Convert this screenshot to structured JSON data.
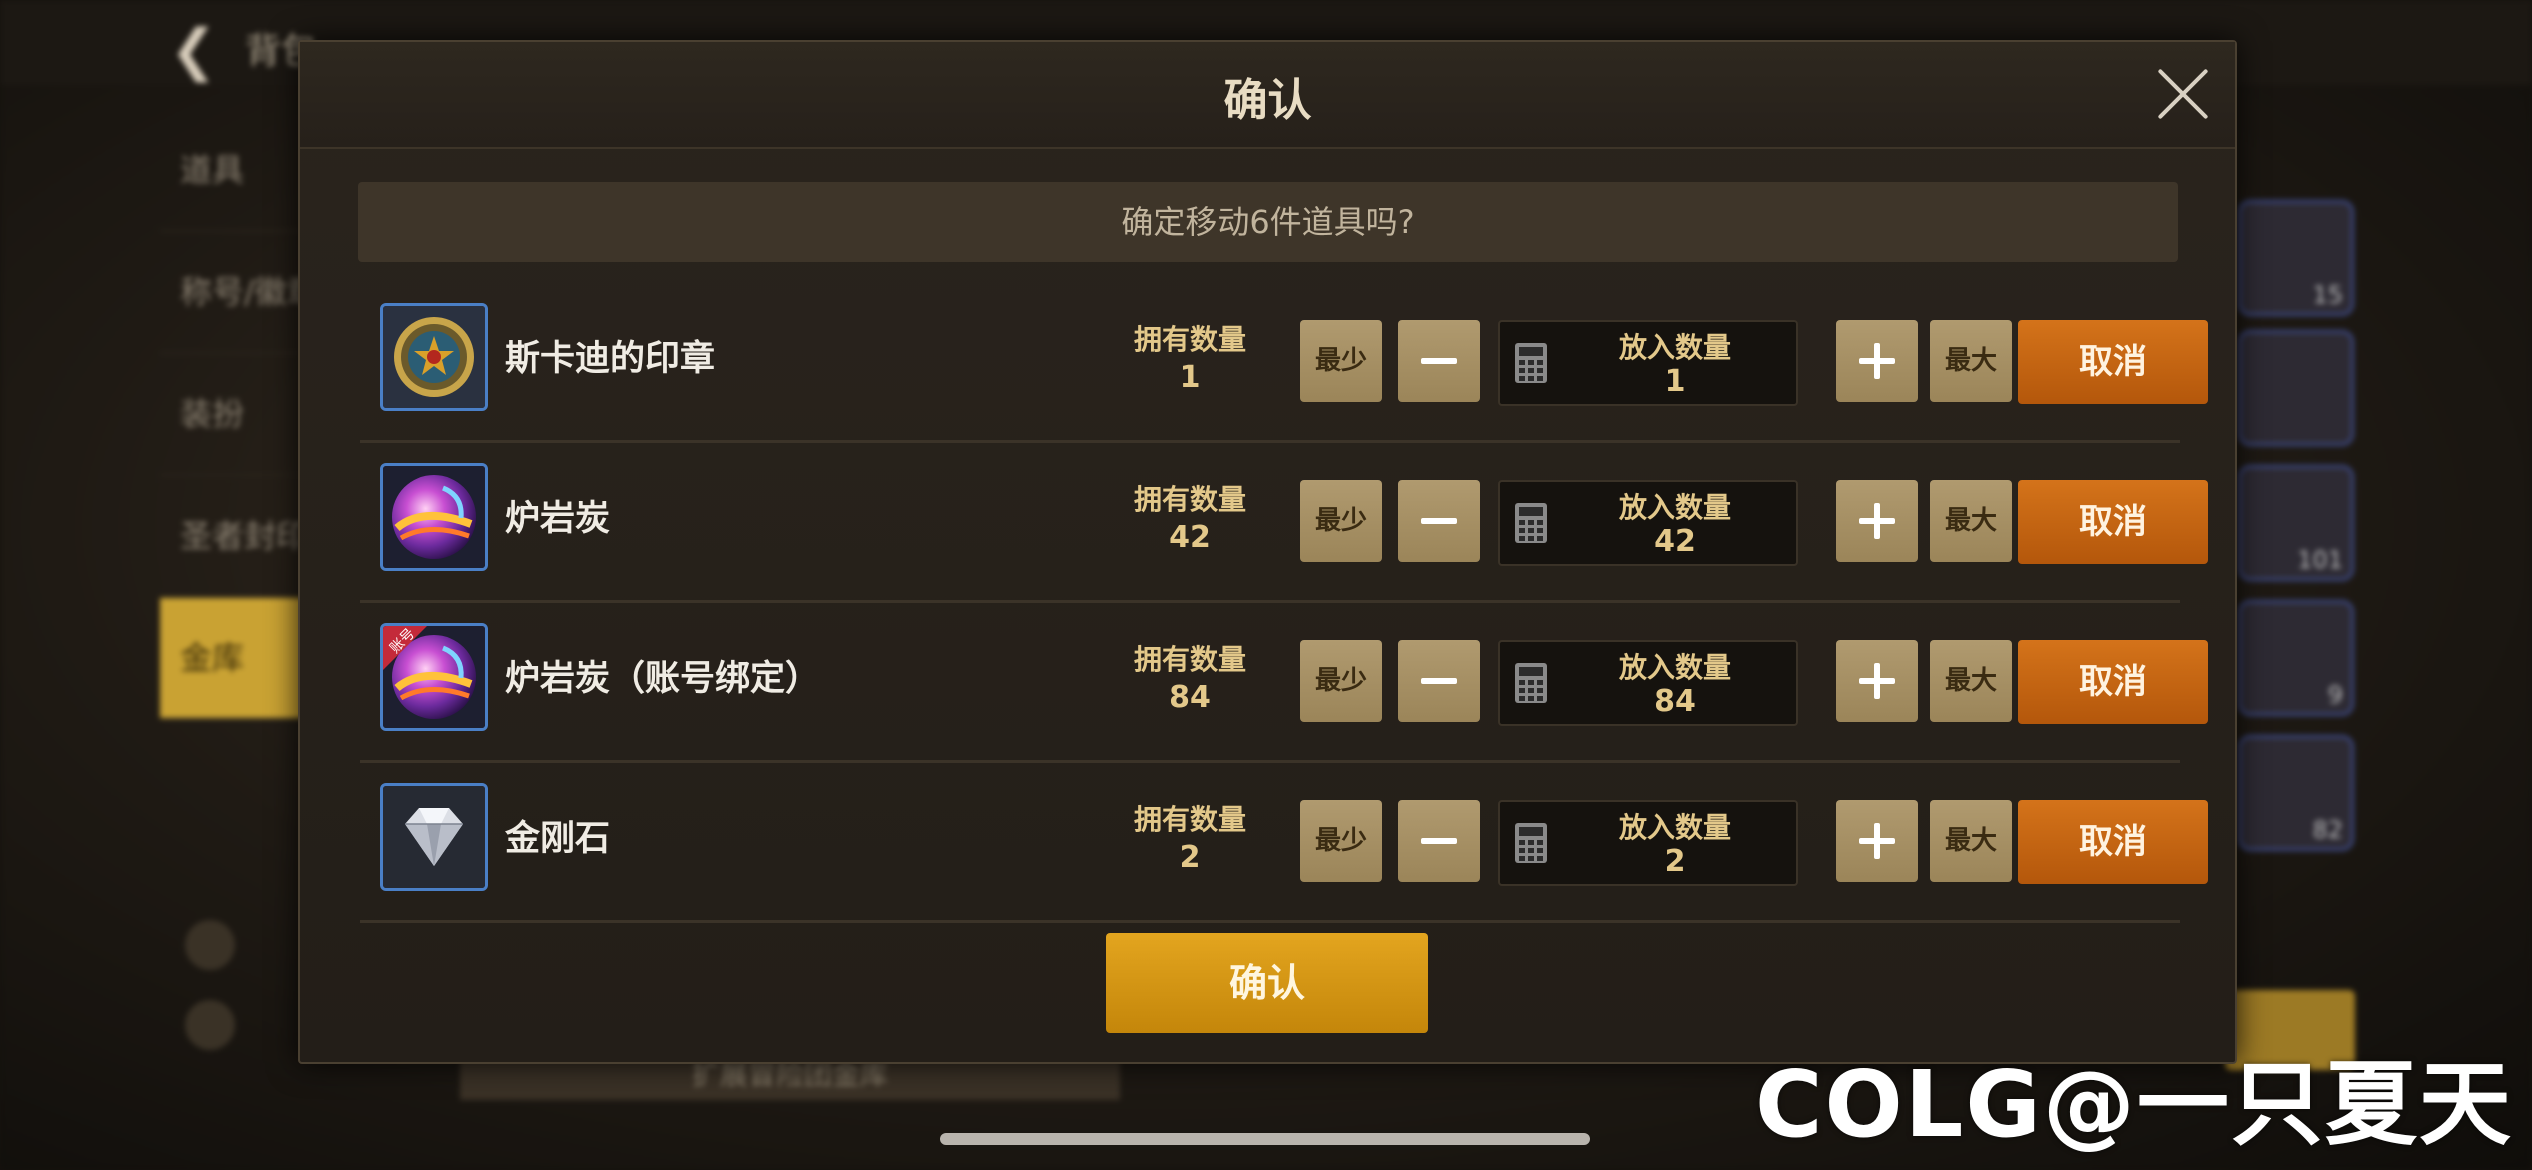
{
  "background": {
    "top_title": "背包",
    "sidebar_items": [
      "道具",
      "称号/徽章",
      "装扮",
      "圣者封印",
      "金库"
    ],
    "active_sidebar_index": 4,
    "bottom_button": "扩展冒险团金库",
    "right_slot_counts": [
      "15",
      "",
      "101",
      "9",
      "82"
    ]
  },
  "dialog": {
    "title": "确认",
    "question": "确定移动6件道具吗?",
    "confirm_label": "确认",
    "items": [
      {
        "name": "斯卡迪的印章",
        "owned_label": "拥有数量",
        "owned": "1",
        "min_label": "最少",
        "qty_label": "放入数量",
        "qty": "1",
        "max_label": "最大",
        "cancel_label": "取消",
        "icon": "seal-icon"
      },
      {
        "name": "炉岩炭",
        "owned_label": "拥有数量",
        "owned": "42",
        "min_label": "最少",
        "qty_label": "放入数量",
        "qty": "42",
        "max_label": "最大",
        "cancel_label": "取消",
        "icon": "furnace-coal-icon"
      },
      {
        "name": "炉岩炭（账号绑定）",
        "owned_label": "拥有数量",
        "owned": "84",
        "min_label": "最少",
        "qty_label": "放入数量",
        "qty": "84",
        "max_label": "最大",
        "cancel_label": "取消",
        "icon": "furnace-coal-bound-icon",
        "icon_badge": "账号"
      },
      {
        "name": "金刚石",
        "owned_label": "拥有数量",
        "owned": "2",
        "min_label": "最少",
        "qty_label": "放入数量",
        "qty": "2",
        "max_label": "最大",
        "cancel_label": "取消",
        "icon": "diamond-icon"
      }
    ]
  },
  "watermark": "COLG@一只夏天",
  "colors": {
    "cancel": "#c4650f",
    "confirm": "#d69613",
    "icon_border": "#4a7fc6",
    "qty_text": "#e3c88a"
  }
}
